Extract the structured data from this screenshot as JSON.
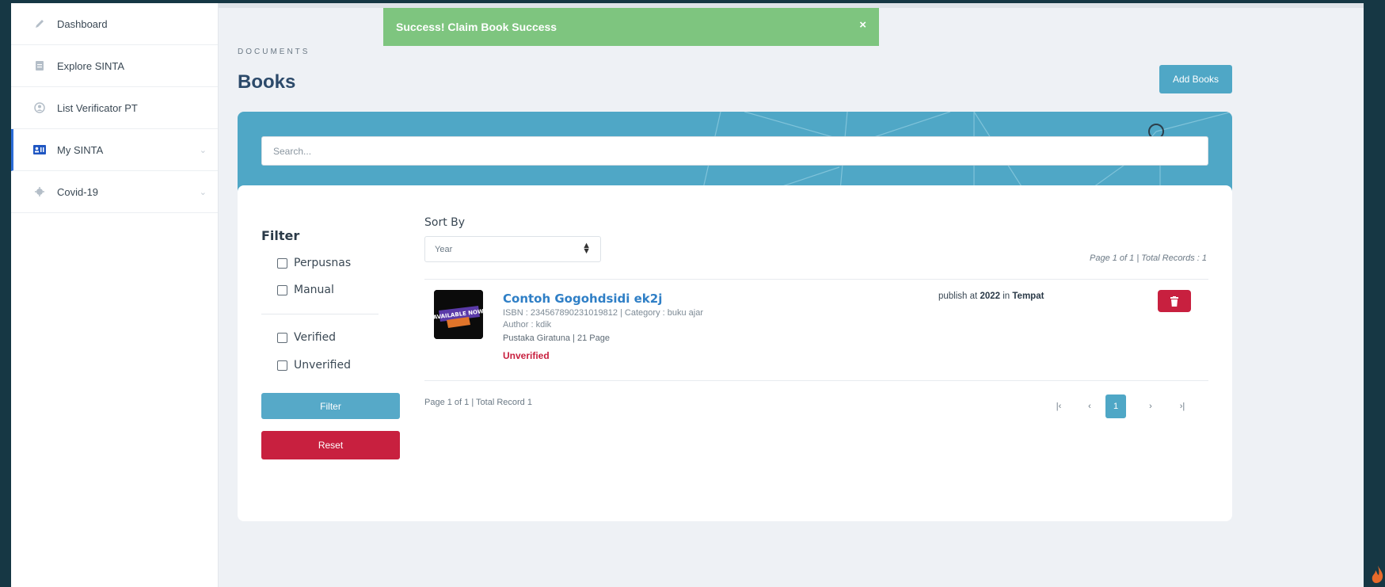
{
  "sidebar": {
    "items": [
      {
        "label": "Dashboard",
        "icon": "pencil-icon"
      },
      {
        "label": "Explore SINTA",
        "icon": "document-icon"
      },
      {
        "label": "List Verificator PT",
        "icon": "user-circle-icon"
      },
      {
        "label": "My SINTA",
        "icon": "id-card-icon",
        "active": true
      },
      {
        "label": "Covid-19",
        "icon": "virus-icon"
      }
    ]
  },
  "alert": {
    "message": "Success! Claim Book Success",
    "close": "×",
    "color": "#7ec57f"
  },
  "header": {
    "breadcrumb": "DOCUMENTS",
    "title": "Books",
    "add_button": "Add Books"
  },
  "search": {
    "placeholder": "Search..."
  },
  "filter": {
    "title": "Filter",
    "options": [
      "Perpusnas",
      "Manual",
      "Verified",
      "Unverified"
    ],
    "filter_button": "Filter",
    "reset_button": "Reset"
  },
  "sort": {
    "label": "Sort By",
    "selected": "Year"
  },
  "results": {
    "page_info_top": "Page 1 of 1 | Total Records : 1",
    "page_info_bottom": "Page 1 of 1 | Total Record 1"
  },
  "book": {
    "cover_text": "AVAILABLE NOW",
    "title": "Contoh Gogohdsidi ek2j",
    "isbn_line": "ISBN : 234567890231019812   |   Category : buku ajar",
    "author_line": "Author : kdik",
    "publisher_line": "Pustaka Giratuna   |   21 Page",
    "status": "Unverified",
    "publish_prefix": "publish at",
    "publish_year": "2022",
    "publish_in": "in",
    "publish_place": "Tempat"
  },
  "pagination": {
    "first": "|‹",
    "prev": "‹",
    "current": "1",
    "next": "›",
    "last": "›|"
  },
  "colors": {
    "accent": "#4fa7c6",
    "danger": "#c8203f",
    "link": "#2f7fc6",
    "success": "#7ec57f"
  }
}
